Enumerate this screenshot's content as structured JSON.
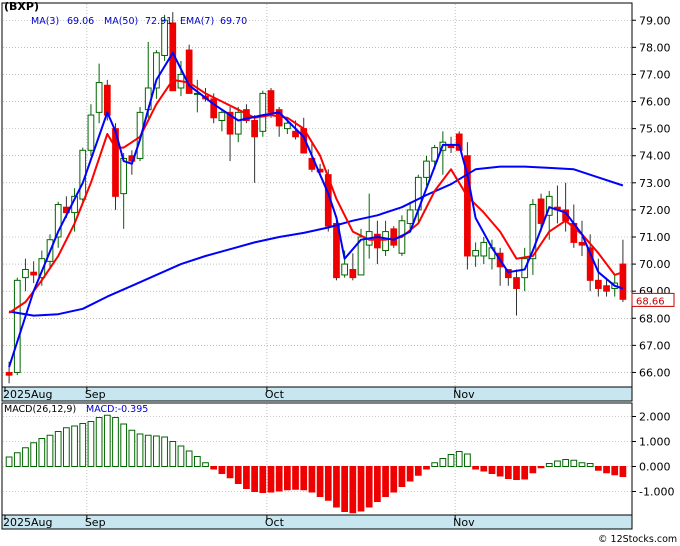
{
  "chart_data": [
    {
      "type": "candlestick",
      "ticker": "(BXP)",
      "indicators": {
        "ma3": {
          "label": "MA(3)",
          "value": "69.06",
          "color": "#0000ff"
        },
        "ma50": {
          "label": "MA(50)",
          "value": "72.91",
          "color": "#0000ff"
        },
        "ema7": {
          "label": "EMA(7)",
          "value": "69.70",
          "color": "#ff0000"
        }
      },
      "last_price": "68.66",
      "ylim": [
        65.5,
        79.6
      ],
      "y_ticks": [
        "79.00",
        "78.00",
        "77.00",
        "76.00",
        "75.00",
        "74.00",
        "73.00",
        "72.00",
        "71.00",
        "70.00",
        "69.00",
        "68.00",
        "67.00",
        "66.00"
      ],
      "x_labels": [
        {
          "label": "2025Aug",
          "index": 0
        },
        {
          "label": "Sep",
          "index": 10
        },
        {
          "label": "Oct",
          "index": 32
        },
        {
          "label": "Nov",
          "index": 55
        }
      ],
      "candles": [
        [
          66.0,
          66.4,
          65.6,
          65.9
        ],
        [
          66.0,
          69.5,
          65.9,
          69.4
        ],
        [
          69.5,
          70.2,
          69.0,
          69.8
        ],
        [
          69.7,
          70.1,
          69.3,
          69.6
        ],
        [
          69.5,
          70.5,
          69.2,
          70.2
        ],
        [
          70.1,
          71.1,
          69.8,
          70.9
        ],
        [
          71.0,
          72.3,
          70.6,
          72.2
        ],
        [
          72.1,
          72.5,
          71.7,
          71.9
        ],
        [
          71.9,
          72.8,
          71.2,
          72.5
        ],
        [
          72.4,
          74.3,
          72.3,
          74.2
        ],
        [
          74.2,
          75.9,
          74.0,
          75.5
        ],
        [
          75.6,
          77.4,
          75.2,
          76.7
        ],
        [
          76.6,
          76.8,
          75.3,
          75.5
        ],
        [
          75.0,
          75.2,
          72.0,
          72.5
        ],
        [
          72.6,
          74.1,
          71.3,
          73.9
        ],
        [
          74.0,
          74.2,
          73.3,
          73.8
        ],
        [
          73.9,
          75.8,
          73.8,
          75.6
        ],
        [
          75.7,
          78.2,
          75.4,
          76.5
        ],
        [
          76.5,
          77.9,
          76.1,
          77.8
        ],
        [
          77.7,
          79.2,
          77.5,
          79.0
        ],
        [
          78.9,
          79.3,
          76.4,
          76.4
        ],
        [
          76.5,
          77.5,
          76.2,
          77.0
        ],
        [
          77.9,
          78.1,
          76.3,
          76.3
        ],
        [
          76.3,
          76.8,
          75.6,
          76.3
        ],
        [
          76.2,
          76.5,
          76.0,
          76.1
        ],
        [
          76.1,
          76.3,
          75.2,
          75.4
        ],
        [
          75.3,
          75.7,
          74.9,
          75.6
        ],
        [
          75.6,
          75.8,
          73.8,
          74.8
        ],
        [
          74.8,
          75.8,
          74.5,
          75.6
        ],
        [
          75.7,
          75.9,
          75.2,
          75.3
        ],
        [
          75.3,
          75.5,
          73.0,
          74.7
        ],
        [
          74.9,
          76.4,
          74.7,
          76.3
        ],
        [
          76.4,
          76.5,
          75.4,
          75.6
        ],
        [
          75.7,
          75.8,
          74.7,
          75.1
        ],
        [
          75.0,
          75.4,
          74.8,
          75.2
        ],
        [
          74.9,
          75.3,
          74.6,
          74.7
        ],
        [
          75.0,
          75.4,
          74.1,
          74.1
        ],
        [
          73.9,
          74.5,
          73.4,
          73.5
        ],
        [
          73.5,
          73.7,
          73.3,
          73.4
        ],
        [
          73.3,
          73.5,
          71.2,
          71.4
        ],
        [
          71.5,
          71.7,
          69.4,
          69.5
        ],
        [
          69.6,
          70.5,
          69.5,
          70.0
        ],
        [
          69.8,
          70.4,
          69.4,
          69.5
        ],
        [
          69.6,
          71.3,
          69.6,
          71.0
        ],
        [
          70.7,
          72.6,
          70.2,
          71.2
        ],
        [
          71.1,
          71.6,
          70.0,
          70.6
        ],
        [
          70.5,
          71.6,
          70.3,
          71.2
        ],
        [
          71.3,
          71.4,
          70.6,
          70.7
        ],
        [
          70.4,
          71.8,
          70.3,
          71.6
        ],
        [
          71.5,
          72.3,
          71.3,
          72.0
        ],
        [
          72.0,
          73.3,
          71.5,
          73.2
        ],
        [
          73.2,
          74.0,
          72.9,
          73.8
        ],
        [
          73.8,
          74.4,
          73.5,
          74.3
        ],
        [
          74.2,
          74.9,
          73.3,
          74.5
        ],
        [
          74.4,
          74.7,
          74.1,
          74.3
        ],
        [
          74.8,
          74.9,
          74.2,
          74.2
        ],
        [
          74.0,
          74.5,
          69.8,
          70.3
        ],
        [
          70.3,
          70.8,
          69.9,
          70.5
        ],
        [
          70.3,
          71.0,
          70.0,
          70.8
        ],
        [
          70.2,
          70.9,
          69.8,
          70.6
        ],
        [
          70.4,
          70.6,
          69.2,
          69.9
        ],
        [
          69.8,
          69.8,
          69.2,
          69.5
        ],
        [
          69.5,
          69.8,
          68.1,
          69.1
        ],
        [
          69.5,
          70.6,
          69.0,
          70.2
        ],
        [
          70.2,
          72.4,
          69.6,
          72.2
        ],
        [
          72.4,
          72.6,
          71.2,
          71.5
        ],
        [
          71.8,
          72.7,
          70.9,
          72.5
        ],
        [
          72.1,
          72.9,
          71.5,
          72.0
        ],
        [
          72.0,
          73.0,
          71.2,
          71.6
        ],
        [
          71.5,
          72.2,
          70.6,
          70.8
        ],
        [
          70.8,
          71.6,
          70.3,
          70.7
        ],
        [
          70.6,
          71.1,
          69.0,
          69.4
        ],
        [
          69.4,
          70.2,
          68.8,
          69.1
        ],
        [
          69.2,
          69.5,
          68.8,
          69.0
        ],
        [
          69.1,
          69.6,
          68.8,
          69.3
        ],
        [
          70.0,
          70.9,
          68.6,
          68.7
        ]
      ],
      "ma3_line": [
        [
          0,
          66.2
        ],
        [
          3,
          69.0
        ],
        [
          6,
          71.2
        ],
        [
          9,
          73.0
        ],
        [
          12,
          75.6
        ],
        [
          13,
          74.9
        ],
        [
          14,
          73.8
        ],
        [
          15,
          73.7
        ],
        [
          16,
          74.6
        ],
        [
          18,
          76.8
        ],
        [
          20,
          77.8
        ],
        [
          22,
          76.6
        ],
        [
          25,
          75.9
        ],
        [
          28,
          75.3
        ],
        [
          31,
          75.5
        ],
        [
          33,
          75.6
        ],
        [
          36,
          74.7
        ],
        [
          39,
          72.6
        ],
        [
          40,
          71.7
        ],
        [
          41,
          70.2
        ],
        [
          43,
          70.9
        ],
        [
          45,
          71.0
        ],
        [
          47,
          70.9
        ],
        [
          49,
          71.2
        ],
        [
          51,
          72.8
        ],
        [
          53,
          74.4
        ],
        [
          55,
          74.4
        ],
        [
          56,
          73.3
        ],
        [
          57,
          71.7
        ],
        [
          59,
          70.6
        ],
        [
          61,
          69.7
        ],
        [
          63,
          69.8
        ],
        [
          64,
          70.5
        ],
        [
          66,
          72.1
        ],
        [
          68,
          71.9
        ],
        [
          70,
          71.1
        ],
        [
          72,
          69.7
        ],
        [
          74,
          69.2
        ],
        [
          75,
          69.1
        ]
      ],
      "ema7_line": [
        [
          0,
          68.2
        ],
        [
          2,
          68.6
        ],
        [
          4,
          69.4
        ],
        [
          6,
          70.3
        ],
        [
          8,
          71.5
        ],
        [
          10,
          73.0
        ],
        [
          12,
          74.8
        ],
        [
          13,
          74.3
        ],
        [
          14,
          74.3
        ],
        [
          16,
          74.7
        ],
        [
          18,
          75.9
        ],
        [
          20,
          76.8
        ],
        [
          22,
          76.7
        ],
        [
          24,
          76.3
        ],
        [
          26,
          76.0
        ],
        [
          28,
          75.7
        ],
        [
          30,
          75.4
        ],
        [
          32,
          75.5
        ],
        [
          34,
          75.4
        ],
        [
          36,
          75.0
        ],
        [
          38,
          74.0
        ],
        [
          40,
          72.4
        ],
        [
          42,
          71.2
        ],
        [
          44,
          70.9
        ],
        [
          46,
          70.9
        ],
        [
          48,
          71.0
        ],
        [
          50,
          71.5
        ],
        [
          52,
          72.7
        ],
        [
          54,
          73.5
        ],
        [
          56,
          72.5
        ],
        [
          58,
          71.9
        ],
        [
          60,
          71.2
        ],
        [
          62,
          70.2
        ],
        [
          64,
          70.3
        ],
        [
          66,
          71.2
        ],
        [
          68,
          71.6
        ],
        [
          70,
          71.1
        ],
        [
          72,
          70.4
        ],
        [
          74,
          69.6
        ],
        [
          75,
          69.7
        ]
      ],
      "ma50_line": [
        [
          0,
          68.25
        ],
        [
          3,
          68.1
        ],
        [
          6,
          68.15
        ],
        [
          9,
          68.35
        ],
        [
          12,
          68.8
        ],
        [
          15,
          69.2
        ],
        [
          18,
          69.6
        ],
        [
          21,
          70.0
        ],
        [
          24,
          70.3
        ],
        [
          27,
          70.55
        ],
        [
          30,
          70.8
        ],
        [
          33,
          71.0
        ],
        [
          36,
          71.15
        ],
        [
          39,
          71.35
        ],
        [
          42,
          71.6
        ],
        [
          45,
          71.8
        ],
        [
          48,
          72.1
        ],
        [
          51,
          72.55
        ],
        [
          54,
          72.95
        ],
        [
          57,
          73.5
        ],
        [
          60,
          73.6
        ],
        [
          63,
          73.6
        ],
        [
          66,
          73.55
        ],
        [
          69,
          73.5
        ],
        [
          72,
          73.2
        ],
        [
          75,
          72.9
        ]
      ]
    },
    {
      "type": "bar",
      "label": "MACD(26,12,9)",
      "value_label": "MACD:-0.395",
      "ylim": [
        -1.9,
        2.5
      ],
      "y_ticks": [
        "2.000",
        "1.000",
        "0.000",
        "-1.000"
      ],
      "x_labels": [
        {
          "label": "2025Aug",
          "index": 0
        },
        {
          "label": "Sep",
          "index": 10
        },
        {
          "label": "Oct",
          "index": 32
        },
        {
          "label": "Nov",
          "index": 55
        }
      ],
      "histogram": [
        0.38,
        0.55,
        0.75,
        0.95,
        1.12,
        1.25,
        1.4,
        1.55,
        1.62,
        1.72,
        1.8,
        1.96,
        2.05,
        1.96,
        1.7,
        1.45,
        1.3,
        1.25,
        1.22,
        1.18,
        1.0,
        0.82,
        0.62,
        0.4,
        0.15,
        -0.1,
        -0.28,
        -0.45,
        -0.68,
        -0.88,
        -1.0,
        -1.04,
        -1.02,
        -0.98,
        -0.93,
        -0.91,
        -0.93,
        -1.02,
        -1.2,
        -1.35,
        -1.62,
        -1.8,
        -1.85,
        -1.78,
        -1.62,
        -1.4,
        -1.2,
        -1.02,
        -0.8,
        -0.58,
        -0.35,
        -0.1,
        0.15,
        0.32,
        0.48,
        0.6,
        0.5,
        -0.1,
        -0.18,
        -0.28,
        -0.38,
        -0.48,
        -0.52,
        -0.5,
        -0.25,
        -0.05,
        0.12,
        0.22,
        0.28,
        0.25,
        0.15,
        0.12,
        -0.15,
        -0.25,
        -0.33,
        -0.4
      ]
    }
  ],
  "watermark": "© 12Stocks.com",
  "colors": {
    "up": "#006600",
    "down": "#ee0000",
    "ma": "#0000ff",
    "ema": "#ff0000",
    "axis_band": "#c8e6f0",
    "price_box_text": "#cc0000"
  }
}
